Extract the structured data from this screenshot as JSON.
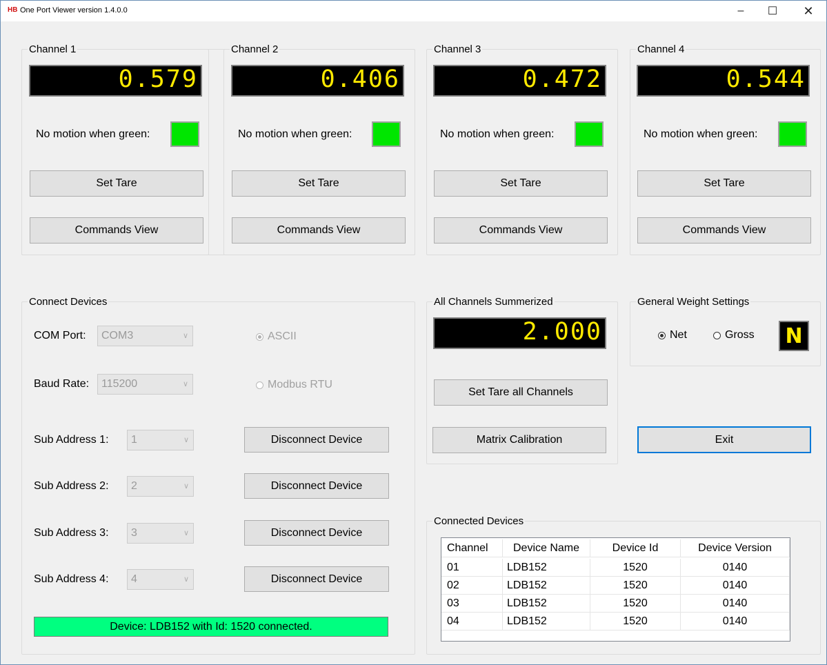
{
  "window": {
    "logo": "HB",
    "title": "One Port Viewer  version 1.4.0.0",
    "minimize_glyph": "–",
    "maximize_glyph": "☐",
    "close_glyph": "✕"
  },
  "channels": [
    {
      "title": "Channel 1",
      "value": "0.579",
      "motion_label": "No motion when green:",
      "tare_label": "Set Tare",
      "commands_label": "Commands View",
      "motion_color": "#00e600"
    },
    {
      "title": "Channel 2",
      "value": "0.406",
      "motion_label": "No motion when green:",
      "tare_label": "Set Tare",
      "commands_label": "Commands View",
      "motion_color": "#00e600"
    },
    {
      "title": "Channel 3",
      "value": "0.472",
      "motion_label": "No motion when green:",
      "tare_label": "Set Tare",
      "commands_label": "Commands View",
      "motion_color": "#00e600"
    },
    {
      "title": "Channel 4",
      "value": "0.544",
      "motion_label": "No motion when green:",
      "tare_label": "Set Tare",
      "commands_label": "Commands View",
      "motion_color": "#00e600"
    }
  ],
  "connect": {
    "title": "Connect Devices",
    "com_port_label": "COM Port:",
    "com_port_value": "COM3",
    "baud_rate_label": "Baud Rate:",
    "baud_rate_value": "115200",
    "protocol_ascii": "ASCII",
    "protocol_modbus": "Modbus RTU",
    "protocol_selected": "ASCII",
    "sub_addresses": [
      {
        "label": "Sub Address 1:",
        "value": "1",
        "button": "Disconnect Device"
      },
      {
        "label": "Sub Address 2:",
        "value": "2",
        "button": "Disconnect Device"
      },
      {
        "label": "Sub Address 3:",
        "value": "3",
        "button": "Disconnect Device"
      },
      {
        "label": "Sub Address 4:",
        "value": "4",
        "button": "Disconnect Device"
      }
    ],
    "status": "Device: LDB152 with Id: 1520 connected.",
    "status_color": "#00ff80"
  },
  "summary": {
    "title": "All Channels Summerized",
    "value": "2.000",
    "tare_all_label": "Set Tare all Channels",
    "matrix_label": "Matrix Calibration"
  },
  "weight_settings": {
    "title": "General Weight Settings",
    "net_label": "Net",
    "gross_label": "Gross",
    "selected": "Net",
    "indicator": "N"
  },
  "exit_label": "Exit",
  "devices": {
    "title": "Connected Devices",
    "columns": [
      "Channel",
      "Device Name",
      "Device Id",
      "Device Version"
    ],
    "rows": [
      [
        "01",
        "LDB152",
        "1520",
        "0140"
      ],
      [
        "02",
        "LDB152",
        "1520",
        "0140"
      ],
      [
        "03",
        "LDB152",
        "1520",
        "0140"
      ],
      [
        "04",
        "LDB152",
        "1520",
        "0140"
      ]
    ]
  },
  "colors": {
    "lcd_background": "#000000",
    "lcd_text": "#ffea00",
    "accent": "#0078d7"
  }
}
